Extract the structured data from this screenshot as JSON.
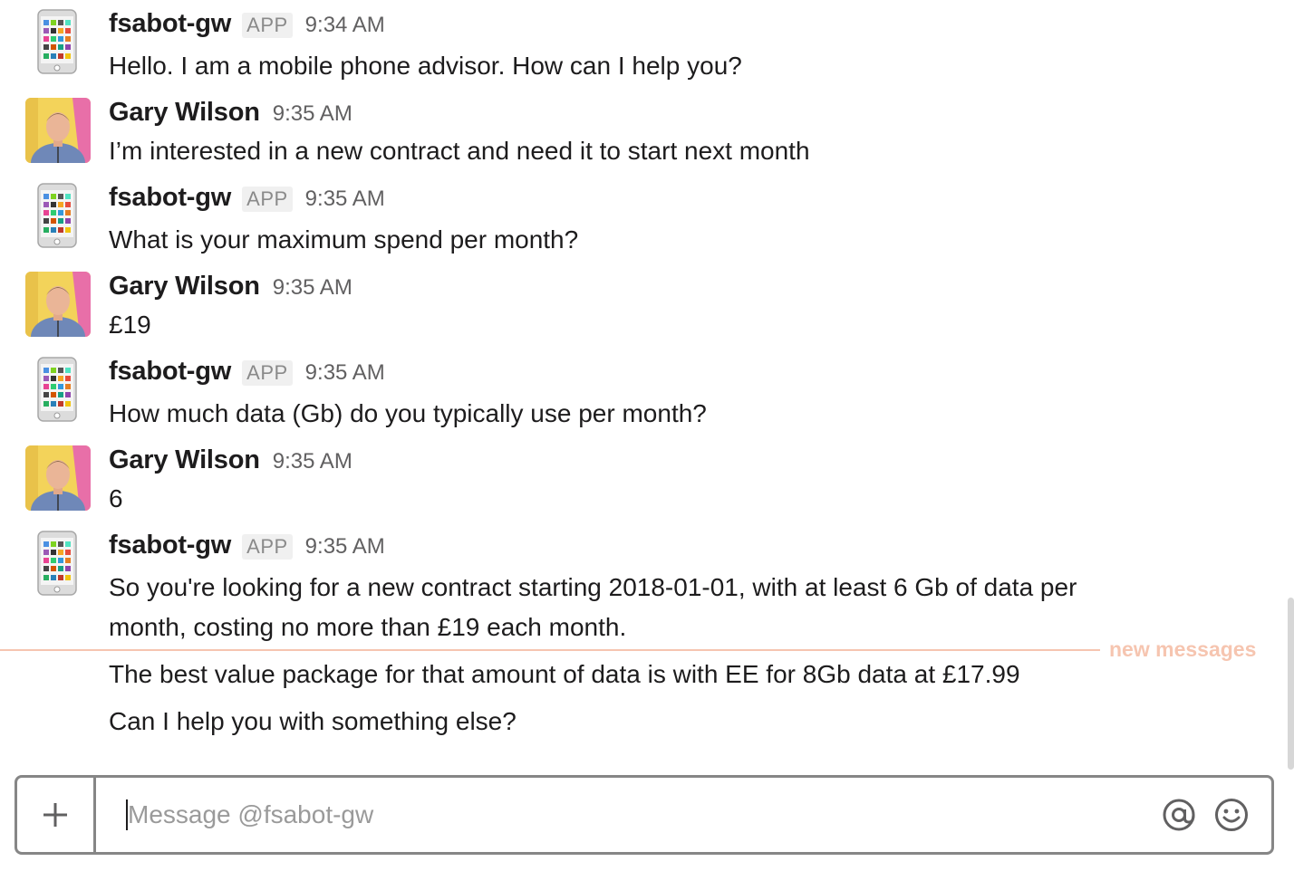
{
  "messages": [
    {
      "author": "fsabot-gw",
      "is_app": true,
      "badge": "APP",
      "time": "9:34 AM",
      "lines": [
        "Hello. I am a mobile phone advisor. How can I help you?"
      ]
    },
    {
      "author": "Gary Wilson",
      "is_app": false,
      "time": "9:35 AM",
      "lines": [
        "I’m interested in a new contract and need it to start next month"
      ]
    },
    {
      "author": "fsabot-gw",
      "is_app": true,
      "badge": "APP",
      "time": "9:35 AM",
      "lines": [
        "What is your maximum spend per month?"
      ]
    },
    {
      "author": "Gary Wilson",
      "is_app": false,
      "time": "9:35 AM",
      "lines": [
        "£19"
      ]
    },
    {
      "author": "fsabot-gw",
      "is_app": true,
      "badge": "APP",
      "time": "9:35 AM",
      "lines": [
        "How much data (Gb) do you typically use per month?"
      ]
    },
    {
      "author": "Gary Wilson",
      "is_app": false,
      "time": "9:35 AM",
      "lines": [
        "6"
      ]
    },
    {
      "author": "fsabot-gw",
      "is_app": true,
      "badge": "APP",
      "time": "9:35 AM",
      "lines": [
        "So you're looking for a new contract starting 2018-01-01, with at least 6 Gb of data per",
        "month, costing no more than £19 each month."
      ]
    }
  ],
  "continuation": [
    "The best value package for that amount of data is with EE for 8Gb data at £17.99",
    "Can I help you with something else?"
  ],
  "divider_label": "new messages",
  "composer": {
    "placeholder": "Message @fsabot-gw",
    "value": ""
  },
  "icons": {
    "bot_avatar": "mobile-phone-icon",
    "user_avatar": "user-photo",
    "attach": "plus-icon",
    "mention": "at-sign-icon",
    "emoji": "smiley-face-icon"
  },
  "colors": {
    "divider": "#f6c5b0",
    "border": "#868686",
    "text": "#1d1c1d",
    "muted": "#616061"
  }
}
